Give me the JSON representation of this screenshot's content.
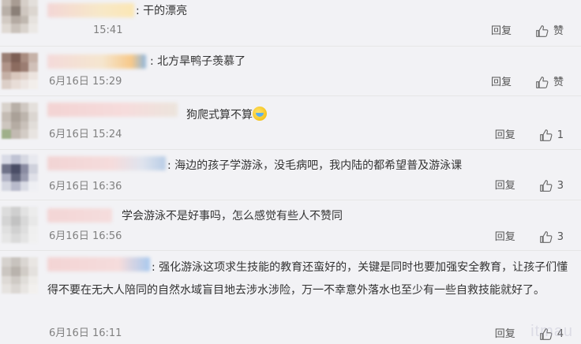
{
  "comments": [
    {
      "text": ": 干的漂亮",
      "time": "15:41",
      "reply": "回复",
      "like": "赞"
    },
    {
      "text": ": 北方旱鸭子羡慕了",
      "time": "6月16日 15:29",
      "reply": "回复",
      "like": "赞"
    },
    {
      "text": "狗爬式算不算",
      "time": "6月16日 15:24",
      "reply": "回复",
      "like": "1"
    },
    {
      "text": ": 海边的孩子学游泳，没毛病吧，我内陆的都希望普及游泳课",
      "time": "6月16日 16:36",
      "reply": "回复",
      "like": "3"
    },
    {
      "text": "学会游泳不是好事吗，怎么感觉有些人不赞同",
      "time": "6月16日 16:56",
      "reply": "回复",
      "like": "3"
    },
    {
      "text": ": 强化游泳这项求生技能的教育还蛮好的，关键是同时也要加强安全教育，让孩子们懂得不要在无大人陪同的自然水域盲目地去涉水涉险，万一不幸意外落水也至少有一些自救技能就好了。",
      "time": "6月16日 16:11",
      "reply": "回复",
      "like": "4"
    }
  ],
  "watermark": "itmau"
}
